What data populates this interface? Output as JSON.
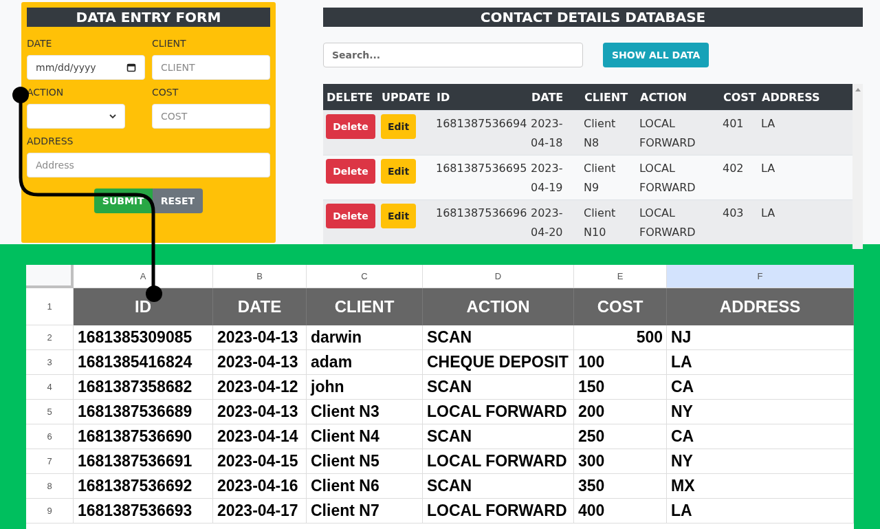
{
  "form": {
    "title": "DATA ENTRY FORM",
    "fields": [
      {
        "kind": "date",
        "label": "DATE",
        "placeholder": "mm/dd/yyyy"
      },
      {
        "kind": "text",
        "label": "CLIENT",
        "placeholder": "CLIENT"
      },
      {
        "kind": "select",
        "label": "ACTION"
      },
      {
        "kind": "text",
        "label": "COST",
        "placeholder": "COST"
      },
      {
        "kind": "wide",
        "label": "ADDRESS",
        "placeholder": "Address"
      }
    ],
    "buttons": [
      {
        "kind": "submit",
        "label": "SUBMIT"
      },
      {
        "kind": "reset",
        "label": "RESET"
      }
    ]
  },
  "database": {
    "title": "CONTACT DETAILS DATABASE",
    "search": {
      "placeholder": "Search..."
    },
    "show_all_button": "SHOW ALL DATA",
    "columns": [
      "DELETE",
      "UPDATE",
      "ID",
      "DATE",
      "CLIENT",
      "ACTION",
      "COST",
      "ADDRESS"
    ],
    "rows": [
      {
        "delete": "Delete",
        "edit": "Edit",
        "id": "1681387536694",
        "date": "2023-04-18",
        "client": "Client N8",
        "action": "LOCAL FORWARD",
        "cost": "401",
        "address": "LA"
      },
      {
        "delete": "Delete",
        "edit": "Edit",
        "id": "1681387536695",
        "date": "2023-04-19",
        "client": "Client N9",
        "action": "LOCAL FORWARD",
        "cost": "402",
        "address": "LA"
      },
      {
        "delete": "Delete",
        "edit": "Edit",
        "id": "1681387536696",
        "date": "2023-04-20",
        "client": "Client N10",
        "action": "LOCAL FORWARD",
        "cost": "403",
        "address": "LA"
      }
    ]
  },
  "sheet": {
    "columns": [
      {
        "letter": "A",
        "selected": false
      },
      {
        "letter": "B",
        "selected": false
      },
      {
        "letter": "C",
        "selected": false
      },
      {
        "letter": "D",
        "selected": false
      },
      {
        "letter": "E",
        "selected": false
      },
      {
        "letter": "F",
        "selected": true
      }
    ],
    "header": {
      "row": "1",
      "cells": [
        "ID",
        "DATE",
        "CLIENT",
        "ACTION",
        "COST",
        "ADDRESS"
      ]
    },
    "rows": [
      {
        "row": "2",
        "cells": [
          "1681385309085",
          "2023-04-13",
          "darwin",
          "SCAN",
          "500",
          "NJ"
        ],
        "cost_is_number": true
      },
      {
        "row": "3",
        "cells": [
          "1681385416824",
          "2023-04-13",
          "adam",
          "CHEQUE DEPOSIT",
          "100",
          "LA"
        ],
        "cost_is_number": false
      },
      {
        "row": "4",
        "cells": [
          "1681387358682",
          "2023-04-12",
          "john",
          "SCAN",
          "150",
          "CA"
        ],
        "cost_is_number": false
      },
      {
        "row": "5",
        "cells": [
          "1681387536689",
          "2023-04-13",
          "Client N3",
          "LOCAL FORWARD",
          "200",
          "NY"
        ],
        "cost_is_number": false
      },
      {
        "row": "6",
        "cells": [
          "1681387536690",
          "2023-04-14",
          "Client N4",
          "SCAN",
          "250",
          "CA"
        ],
        "cost_is_number": false
      },
      {
        "row": "7",
        "cells": [
          "1681387536691",
          "2023-04-15",
          "Client N5",
          "LOCAL FORWARD",
          "300",
          "NY"
        ],
        "cost_is_number": false
      },
      {
        "row": "8",
        "cells": [
          "1681387536692",
          "2023-04-16",
          "Client N6",
          "SCAN",
          "350",
          "MX"
        ],
        "cost_is_number": false
      },
      {
        "row": "9",
        "cells": [
          "1681387536693",
          "2023-04-17",
          "Client N7",
          "LOCAL FORWARD",
          "400",
          "LA"
        ],
        "cost_is_number": false
      }
    ]
  }
}
